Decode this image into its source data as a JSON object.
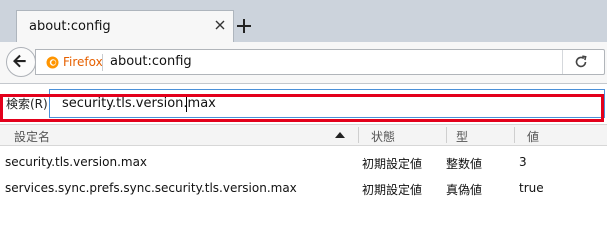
{
  "window": {
    "tab_title": "about:config"
  },
  "navbar": {
    "identity_label": "Firefox",
    "url": "about:config"
  },
  "search": {
    "label": "検索(R):",
    "value": "security.tls.version.max"
  },
  "table": {
    "headers": [
      "設定名",
      "状態",
      "型",
      "値"
    ],
    "sort_column": "設定名",
    "sort_direction": "ascending",
    "rows": [
      {
        "name": "security.tls.version.max",
        "status": "初期設定値",
        "type": "整数値",
        "value": "3"
      },
      {
        "name": "services.sync.prefs.sync.security.tls.version.max",
        "status": "初期設定値",
        "type": "真偽値",
        "value": "true"
      }
    ],
    "highlighted_row": 0
  },
  "colors": {
    "highlight": "#e3001b",
    "brand": "#e66000",
    "focus": "#4a90d9"
  }
}
